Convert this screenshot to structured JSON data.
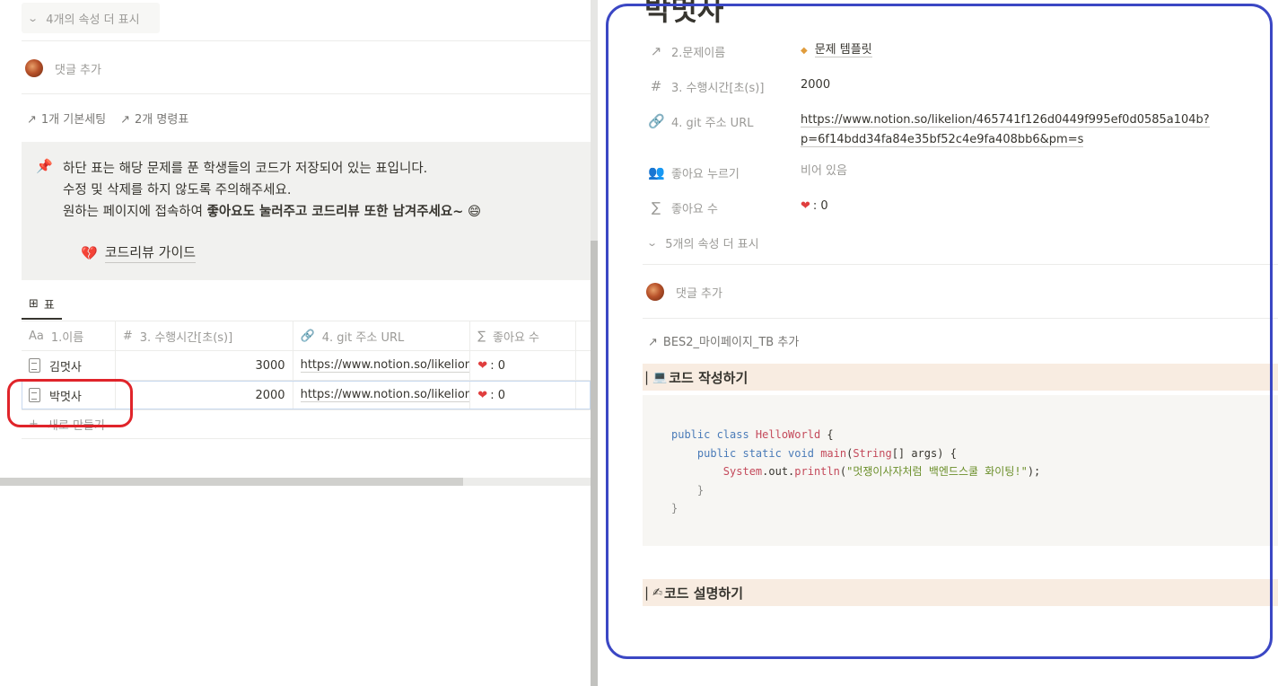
{
  "left": {
    "more_props": "4개의 속성 더 표시",
    "comment_placeholder": "댓글 추가",
    "relation_links": [
      "1개 기본세팅",
      "2개 명령표"
    ],
    "callout": {
      "line1": "하단 표는 해당 문제를 푼 학생들의 코드가 저장되어 있는 표입니다.",
      "line2": "수정 및 삭제를 하지 않도록 주의해주세요.",
      "line3_prefix": "원하는 페이지에 접속하여 ",
      "line3_bold": "좋아요도 눌러주고 코드리뷰 또한 남겨주세요~",
      "line3_emoji": "😄",
      "guide_link": "코드리뷰 가이드"
    },
    "view_tab": "표",
    "table": {
      "headers": [
        "1.이름",
        "3. 수행시간[초(s)]",
        "4. git 주소 URL",
        "좋아요 수"
      ],
      "header_icons": [
        "Aa",
        "#",
        "🔗",
        "∑"
      ],
      "rows": [
        {
          "name": "김멋사",
          "time": "3000",
          "url": "https://www.notion.so/likelion/",
          "likes": ": 0"
        },
        {
          "name": "박멋사",
          "time": "2000",
          "url": "https://www.notion.so/likelion/",
          "likes": ": 0"
        }
      ],
      "new_row": "새로 만들기"
    }
  },
  "right": {
    "title": "박멋사",
    "props": [
      {
        "icon": "↗",
        "name": "2.문제이름",
        "value": "문제 템플릿"
      },
      {
        "icon": "#",
        "name": "3. 수행시간[초(s)]",
        "value": "2000"
      },
      {
        "icon": "🔗",
        "name": "4. git 주소 URL",
        "value_line1": "https://www.notion.so/likelion/465741f126d0449f995ef0d0585a104b?",
        "value_line2": "p=6f14bdd34fa84e35bf52c4e9fa408bb6&pm=s"
      },
      {
        "icon": "👥",
        "name": "좋아요 누르기",
        "value": "비어 있음"
      },
      {
        "icon": "∑",
        "name": "좋아요 수",
        "value": ": 0"
      }
    ],
    "more_props": "5개의 속성 더 표시",
    "comment_placeholder": "댓글 추가",
    "relation_add": "BES2_마이페이지_TB 추가",
    "heading1": "코드 작성하기",
    "heading2": "코드 설명하기",
    "code": {
      "l1_kw": "public class ",
      "l1_cls": "HelloWorld",
      "l1_end": " {",
      "l2_kw": "public static void ",
      "l2_fn": "main",
      "l2_mid": "(",
      "l2_type": "String",
      "l2_end": "[] args) {",
      "l3_obj": "System",
      "l3_mid": ".out.",
      "l3_fn": "println",
      "l3_open": "(",
      "l3_str": "\"멋쟁이사자처럼 백엔드스쿨 화이팅!\"",
      "l3_end": ");",
      "l4": "}",
      "l5": "}"
    }
  },
  "colors": {
    "annotation_red": "#e0242a",
    "annotation_blue": "#3b47c4",
    "heading_bg": "#f8ece1"
  }
}
